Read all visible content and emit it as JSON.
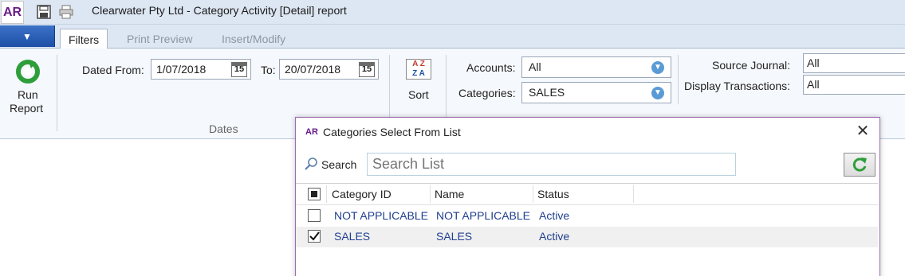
{
  "window": {
    "app_logo": "AR",
    "title": "Clearwater Pty Ltd - Category Activity [Detail] report",
    "quick_access": [
      "save-icon",
      "print-icon"
    ]
  },
  "ribbon": {
    "tabs": [
      "Filters",
      "Print Preview",
      "Insert/Modify"
    ],
    "active_tab": "Filters",
    "run_report_label_1": "Run",
    "run_report_label_2": "Report",
    "dates": {
      "from_label": "Dated From:",
      "from_value": "1/07/2018",
      "to_label": "To:",
      "to_value": "20/07/2018",
      "calendar_day": "15",
      "group_label": "Dates"
    },
    "sort": {
      "label": "Sort",
      "icon_top": "A Z",
      "icon_bottom": "Z A"
    },
    "accounts_label": "Accounts:",
    "accounts_value": "All",
    "categories_label": "Categories:",
    "categories_value": "SALES",
    "source_journal_label": "Source Journal:",
    "source_journal_value": "All",
    "display_transactions_label": "Display Transactions:",
    "display_transactions_value": "All"
  },
  "dialog": {
    "logo": "AR",
    "title": "Categories Select From List",
    "close_icon": "close-icon",
    "search_label": "Search",
    "search_placeholder": "Search List",
    "columns": [
      "Category ID",
      "Name",
      "Status"
    ],
    "rows": [
      {
        "checked": false,
        "category_id": "NOT APPLICABLE",
        "name": "NOT APPLICABLE",
        "status": "Active"
      },
      {
        "checked": true,
        "category_id": "SALES",
        "name": "SALES",
        "status": "Active"
      }
    ]
  },
  "colors": {
    "title_bar": "#dde7f3",
    "menu_button": "#1d4fa6",
    "link_text": "#1f3f8f",
    "accent_purple": "#6a1b8a",
    "refresh_green": "#2e9e3a"
  }
}
